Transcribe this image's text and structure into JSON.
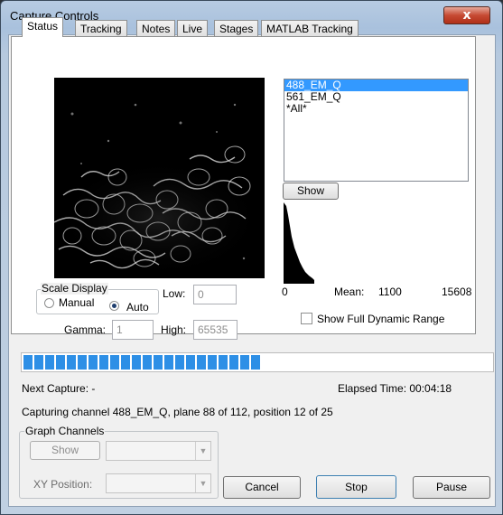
{
  "window": {
    "title": "Capture Controls",
    "close_glyph": "x"
  },
  "tabs": [
    "Status",
    "Tracking",
    "Notes",
    "Live",
    "Stages",
    "MATLAB Tracking"
  ],
  "channels": {
    "items": [
      "488_EM_Q",
      "561_EM_Q",
      "*All*"
    ],
    "selected_index": 0,
    "show_label": "Show"
  },
  "histogram": {
    "min_label": "0",
    "mean_label": "Mean:",
    "mean_value": "1100",
    "max_label": "15608"
  },
  "show_full_range": {
    "label": "Show Full Dynamic Range",
    "checked": false
  },
  "scale_display": {
    "title": "Scale Display",
    "manual_label": "Manual",
    "auto_label": "Auto",
    "selected": "Auto",
    "low_label": "Low:",
    "low_value": "0",
    "high_label": "High:",
    "high_value": "65535",
    "gamma_label": "Gamma:",
    "gamma_value": "1"
  },
  "progress": {
    "fraction": 0.5
  },
  "status": {
    "next_capture": "Next Capture: -",
    "elapsed": "Elapsed Time: 00:04:18",
    "message": "Capturing channel 488_EM_Q, plane 88 of 112, position 12 of 25"
  },
  "graph_channels": {
    "title": "Graph Channels",
    "show_label": "Show",
    "xy_label": "XY Position:"
  },
  "buttons": {
    "cancel": "Cancel",
    "stop": "Stop",
    "pause": "Pause"
  },
  "colors": {
    "selection": "#3399ff",
    "progress": "#2d8fe6",
    "close": "#c64a33"
  },
  "icons": [
    "close-icon",
    "radio-icon",
    "checkbox-icon",
    "dropdown-arrow-icon"
  ]
}
